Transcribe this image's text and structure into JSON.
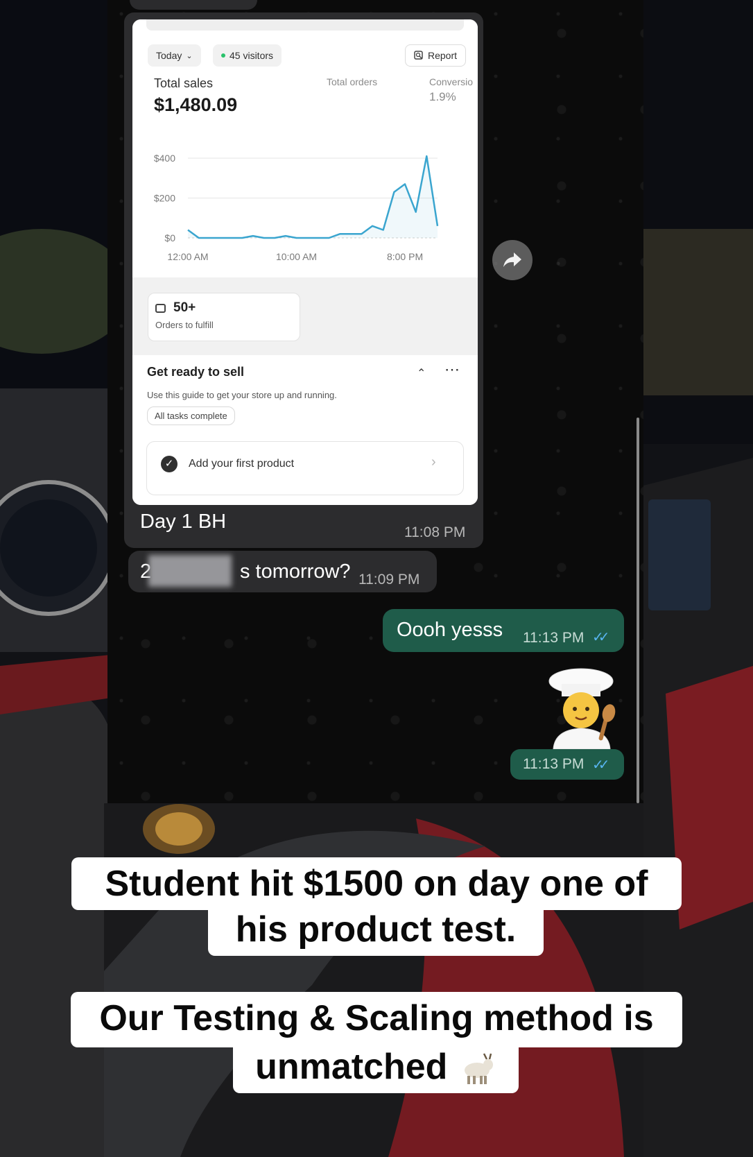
{
  "dashboard": {
    "date_filter": "Today",
    "visitors": "45 visitors",
    "report_label": "Report",
    "total_sales_label": "Total sales",
    "total_sales_value": "$1,480.09",
    "total_orders_label": "Total orders",
    "conversion_label": "Conversio",
    "conversion_value": "1.9%",
    "fulfill_count": "50+",
    "fulfill_label": "Orders to fulfill",
    "sell_title": "Get ready to sell",
    "sell_subtitle": "Use this guide to get your store up and running.",
    "sell_badge": "All tasks complete",
    "task_label": "Add your first product"
  },
  "chart_data": {
    "type": "line",
    "y_ticks": [
      "$400",
      "$200",
      "$0"
    ],
    "x_ticks": [
      "12:00 AM",
      "10:00 AM",
      "8:00 PM"
    ],
    "ylim": [
      0,
      400
    ],
    "x_hours": [
      0,
      1,
      2,
      3,
      4,
      5,
      6,
      7,
      8,
      9,
      10,
      11,
      12,
      13,
      14,
      15,
      16,
      17,
      18,
      19,
      20,
      21,
      22,
      23
    ],
    "values": [
      40,
      0,
      0,
      0,
      0,
      0,
      10,
      0,
      0,
      10,
      0,
      0,
      0,
      0,
      20,
      20,
      20,
      60,
      40,
      230,
      270,
      130,
      410,
      60
    ],
    "line_color": "#3aa5cf",
    "grid": true
  },
  "messages": [
    {
      "caption": "Day 1 BH",
      "time": "11:08 PM"
    },
    {
      "text_prefix": "2",
      "text": "s tomorrow?",
      "time": "11:09 PM"
    },
    {
      "text": "Oooh yesss",
      "time": "11:13 PM"
    },
    {
      "emoji": "chef",
      "time": "11:13 PM"
    }
  ],
  "overlay": {
    "line1a": "Student hit $1500 on day one of",
    "line1b": "his product test.",
    "line2a": "Our Testing & Scaling method is",
    "line2b": "unmatched"
  }
}
